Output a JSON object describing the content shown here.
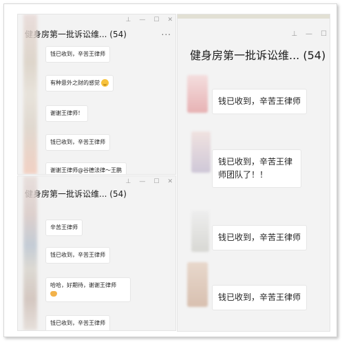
{
  "colors": {
    "window_bg": "#f3f3f3",
    "bubble_bg": "#ffffff",
    "title_text": "#1a1a1a",
    "top_bar_accent": "#e2e0d4"
  },
  "icons": {
    "pin": "pin-icon",
    "minimize": "minimize-icon",
    "maximize": "maximize-icon",
    "close": "close-icon",
    "more": "more-icon"
  },
  "glyphs": {
    "pin": "⊥",
    "minimize": "—",
    "maximize": "☐",
    "close": "✕",
    "more": "..."
  },
  "win1": {
    "title": "健身房第一批诉讼维... (54)",
    "messages": [
      {
        "text": "钱已收到，辛苦王律师"
      },
      {
        "text": "有种意外之财的感觉",
        "emoji": "grin-emoji"
      },
      {
        "text": "谢谢王律师！"
      },
      {
        "text": "钱已收到，辛苦王律师"
      },
      {
        "text": "谢谢王律师@谷德法律～王鹏"
      }
    ]
  },
  "win2": {
    "title": "健身房第一批诉讼维... (54)",
    "messages": [
      {
        "text": "辛苦王律师"
      },
      {
        "text": "钱已收到，辛苦王律师"
      },
      {
        "text": "哈哈，好期待，谢谢王律师",
        "emoji": "clap-emoji"
      },
      {
        "text": "钱已收到，辛苦王律师"
      }
    ]
  },
  "win3": {
    "title": "健身房第一批诉讼维... (54)",
    "messages": [
      {
        "text": "钱已收到，辛苦王律师"
      },
      {
        "text": "钱已收到，辛苦王律师团队了！！"
      },
      {
        "text": "钱已收到，辛苦王律师"
      },
      {
        "text": "钱已收到，辛苦王律师"
      }
    ]
  }
}
